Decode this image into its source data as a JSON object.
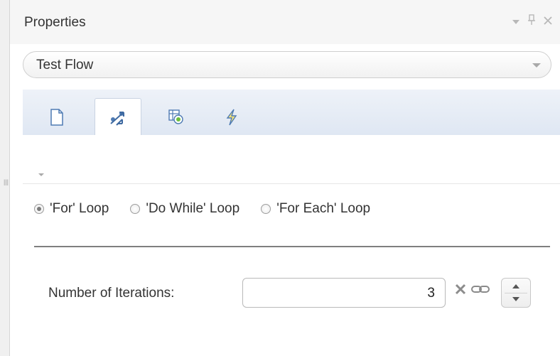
{
  "panel": {
    "title": "Properties"
  },
  "window_controls": {
    "dropdown_icon": "menu-triangle-icon",
    "pin_icon": "pin-icon",
    "close_icon": "close-icon"
  },
  "selector": {
    "value": "Test Flow"
  },
  "tabs": [
    {
      "icon": "document-icon",
      "active": false
    },
    {
      "icon": "loop-flow-icon",
      "active": true
    },
    {
      "icon": "grid-gear-icon",
      "active": false
    },
    {
      "icon": "lightning-icon",
      "active": false
    }
  ],
  "loop_options": [
    {
      "label": "'For' Loop",
      "selected": true
    },
    {
      "label": "'Do While' Loop",
      "selected": false
    },
    {
      "label": "'For Each' Loop",
      "selected": false
    }
  ],
  "iterations": {
    "label": "Number of Iterations:",
    "value": "3"
  },
  "colors": {
    "tab_bg_top": "#eef2f8",
    "tab_bg_bottom": "#dfe7f3",
    "text": "#333333",
    "clear_x": "#8c8c8c"
  }
}
